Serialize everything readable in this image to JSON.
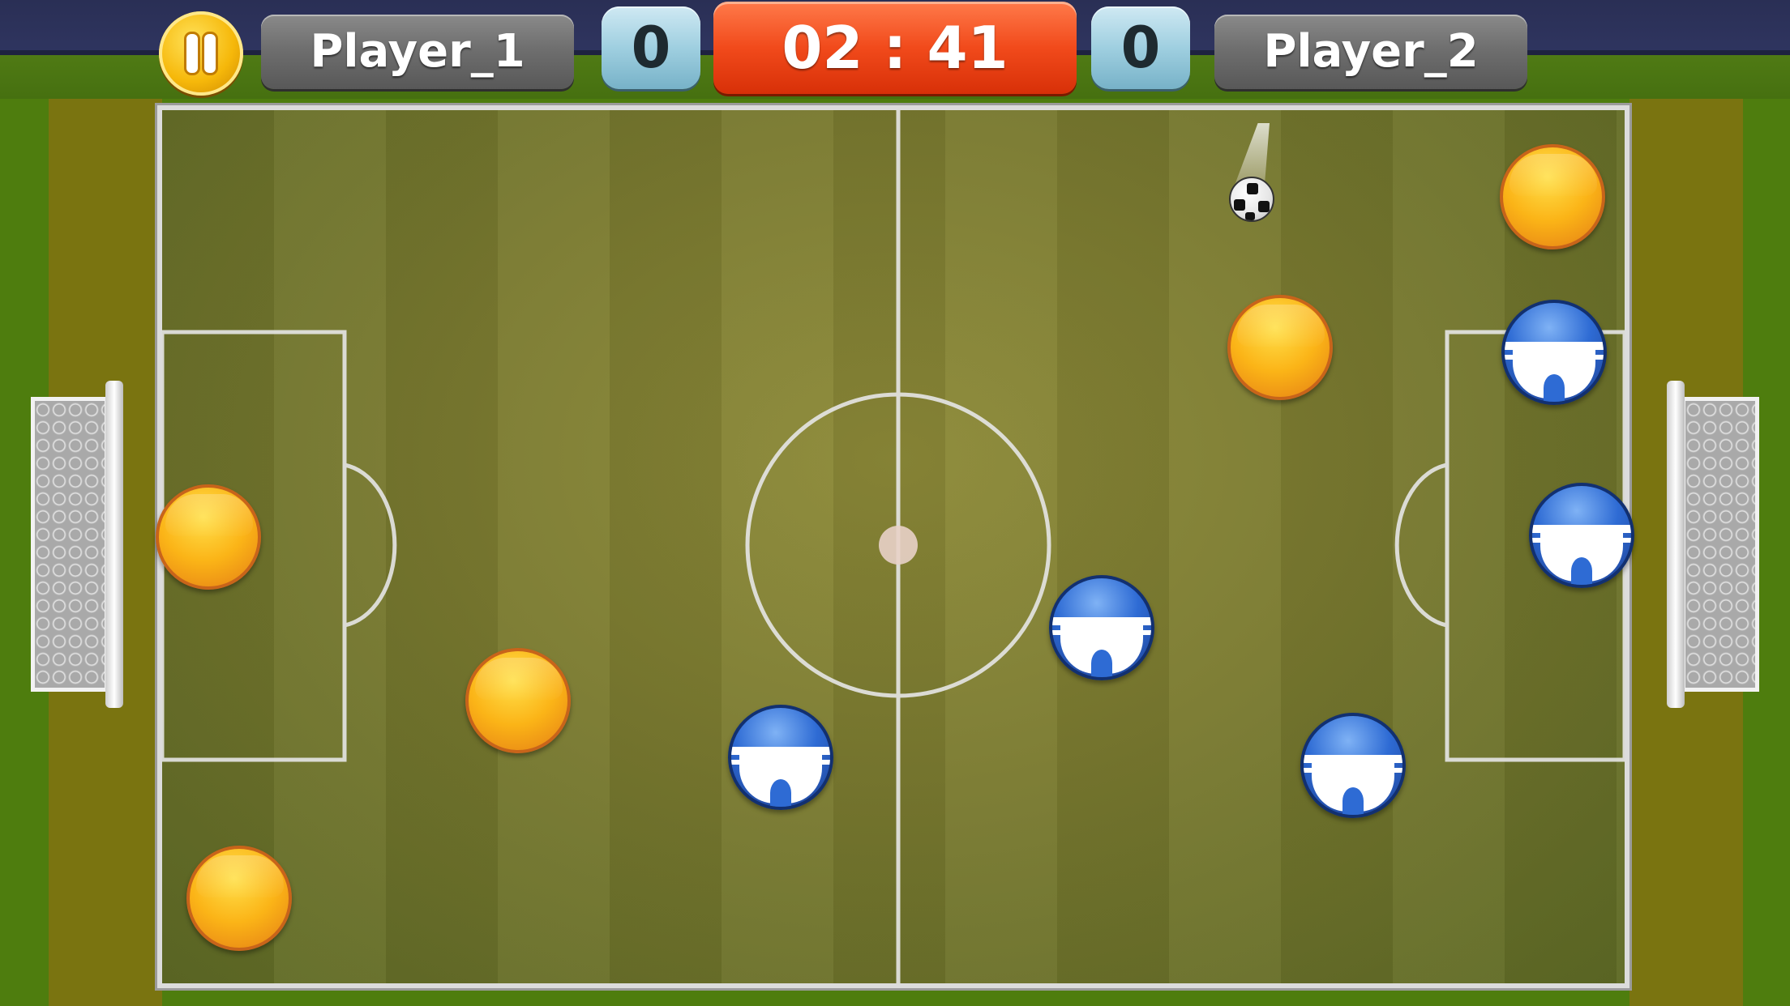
{
  "hud": {
    "player1_name": "Player_1",
    "player2_name": "Player_2",
    "player1_score": "0",
    "player2_score": "0",
    "timer": "02 : 41"
  },
  "icons": {
    "pause": "pause-icon",
    "ball": "soccer-ball-icon"
  },
  "colors": {
    "team_orange": "#fbb417",
    "team_blue": "#2e6bd4",
    "timer_bg": "#f14a1b",
    "score_bg": "#9fcfe0",
    "name_plate_bg": "#6f6f6f",
    "pitch": "#7a7a30",
    "pitch_lines": "#e6e6e6"
  }
}
